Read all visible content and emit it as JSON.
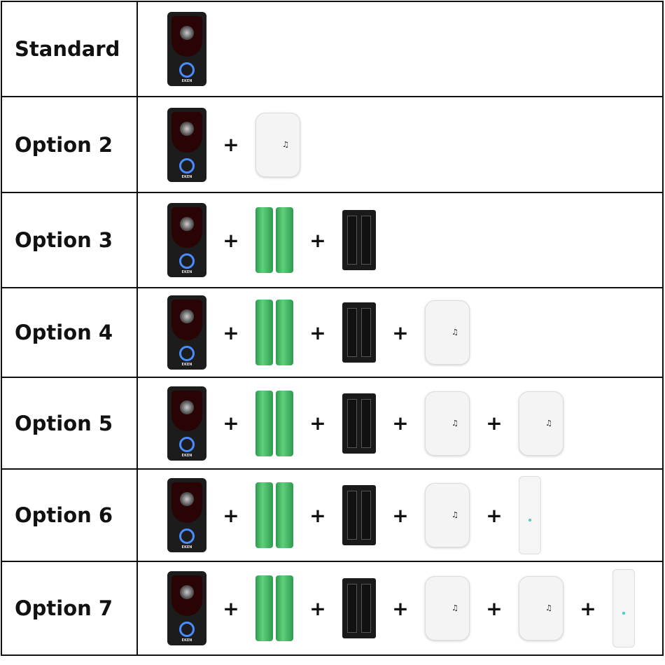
{
  "separator": "+",
  "brand_logo": "EKEN",
  "chime_icon": "music-note-icon",
  "colors": {
    "battery": "#3fbf66",
    "ring": "#4a8cff",
    "border": "#111111"
  },
  "rows": [
    {
      "label": "Standard",
      "items": [
        "doorbell"
      ]
    },
    {
      "label": "Option 2",
      "items": [
        "doorbell",
        "chime"
      ]
    },
    {
      "label": "Option 3",
      "items": [
        "doorbell",
        "batteries",
        "charger"
      ]
    },
    {
      "label": "Option 4",
      "items": [
        "doorbell",
        "batteries",
        "charger",
        "chime"
      ]
    },
    {
      "label": "Option 5",
      "items": [
        "doorbell",
        "batteries",
        "charger",
        "chime",
        "chime"
      ]
    },
    {
      "label": "Option 6",
      "items": [
        "doorbell",
        "batteries",
        "charger",
        "chime",
        "repeater"
      ]
    },
    {
      "label": "Option 7",
      "items": [
        "doorbell",
        "batteries",
        "charger",
        "chime",
        "chime",
        "repeater"
      ]
    }
  ]
}
